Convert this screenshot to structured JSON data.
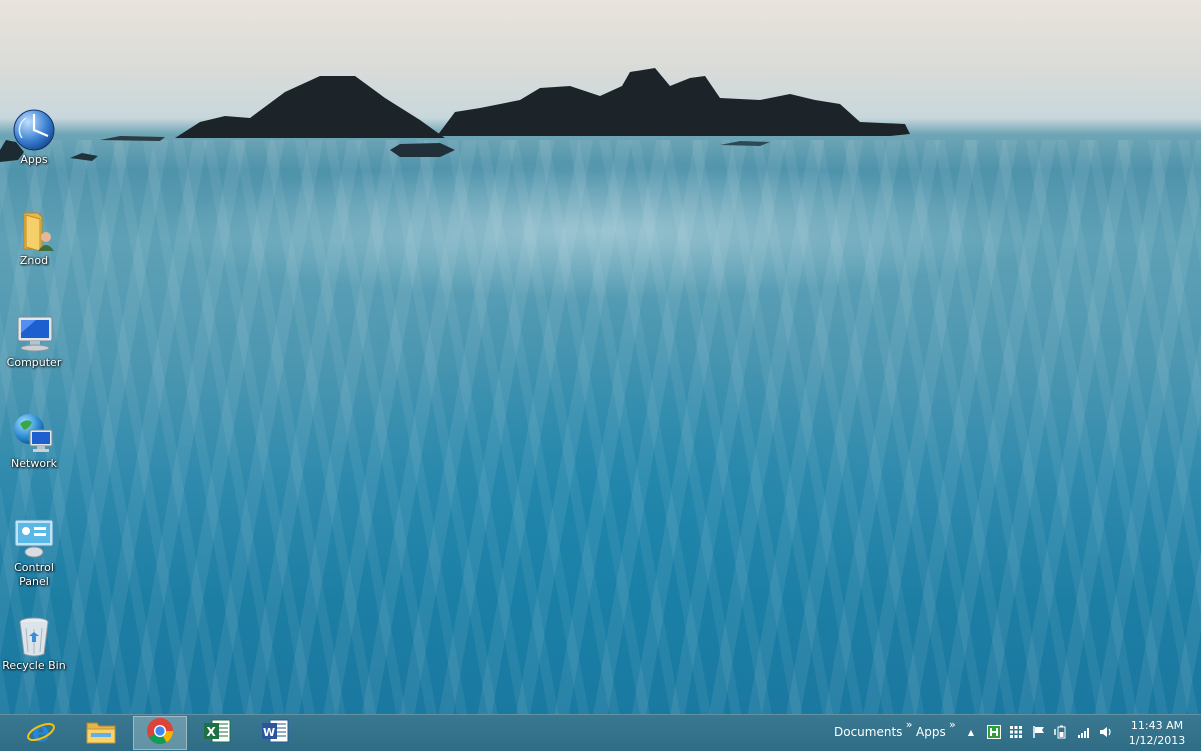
{
  "desktop": {
    "icons": [
      {
        "label": "Apps"
      },
      {
        "label": "Znod"
      },
      {
        "label": "Computer"
      },
      {
        "label": "Network"
      },
      {
        "label": "Control Panel"
      },
      {
        "label": "Recycle Bin"
      }
    ]
  },
  "taskbar": {
    "pinned": [
      {
        "icon": "internet-explorer-icon"
      },
      {
        "icon": "file-explorer-icon"
      },
      {
        "icon": "chrome-icon",
        "active": true
      },
      {
        "icon": "excel-icon"
      },
      {
        "icon": "word-icon"
      }
    ],
    "toolbars": [
      {
        "label": "Documents",
        "chevron": "»"
      },
      {
        "label": "Apps",
        "chevron": "»"
      }
    ],
    "tray_expand": "▲",
    "clock": {
      "time": "11:43 AM",
      "date": "1/12/2013"
    }
  },
  "colors": {
    "taskbar": "#2f6d86",
    "ie_blue": "#1e88e5",
    "excel_green": "#1e7145",
    "word_blue": "#2b579a"
  }
}
